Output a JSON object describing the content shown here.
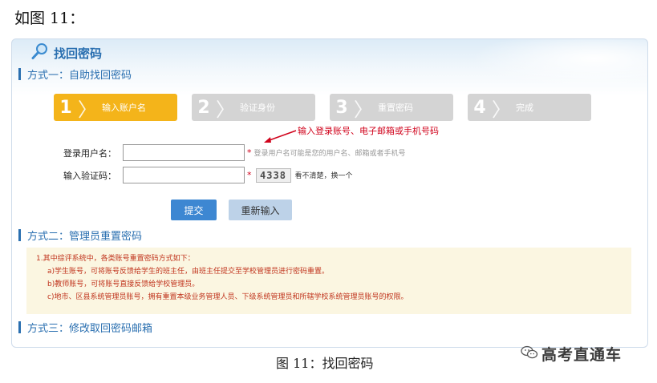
{
  "doc_heading": "如图 11：",
  "panel": {
    "title": "找回密码",
    "icon": "magnifier-icon"
  },
  "method1": {
    "title": "方式一：自助找回密码",
    "steps": [
      {
        "num": "1",
        "label": "输入账户名",
        "active": true
      },
      {
        "num": "2",
        "label": "验证身份",
        "active": false
      },
      {
        "num": "3",
        "label": "重置密码",
        "active": false
      },
      {
        "num": "4",
        "label": "完成",
        "active": false
      }
    ],
    "annotation": "输入登录账号、电子邮箱或手机号码",
    "username_label": "登录用户名：",
    "username_value": "",
    "username_hint": "登录用户名可能是您的用户名、邮箱或者手机号",
    "required_mark": "*",
    "captcha_label": "输入验证码：",
    "captcha_value": "",
    "captcha_text": "4338",
    "captcha_refresh": "看不清楚，换一个",
    "submit_label": "提交",
    "reset_label": "重新输入"
  },
  "method2": {
    "title": "方式二：管理员重置密码",
    "notice_lines": [
      "1.其中综评系统中，各类账号重置密码方式如下：",
      "a)学生账号，可将账号反馈给学生的班主任，由班主任提交至学校管理员进行密码重置。",
      "b)教师账号，可将账号直接反馈给学校管理员。",
      "c)地市、区县系统管理员账号，拥有重置本级业务管理人员、下级系统管理员和所辖学校系统管理员账号的权限。"
    ]
  },
  "method3": {
    "title": "方式三：修改取回密码邮箱"
  },
  "caption": "图 11：找回密码",
  "watermark": "高考直通车",
  "colors": {
    "accent": "#2a6fb0",
    "step_active": "#f4b41a",
    "step_inactive": "#d4d4d4",
    "annotation": "#d0021b",
    "submit": "#3d87d2",
    "reset": "#bdd2e8",
    "notice_bg": "#fbf6e1"
  }
}
